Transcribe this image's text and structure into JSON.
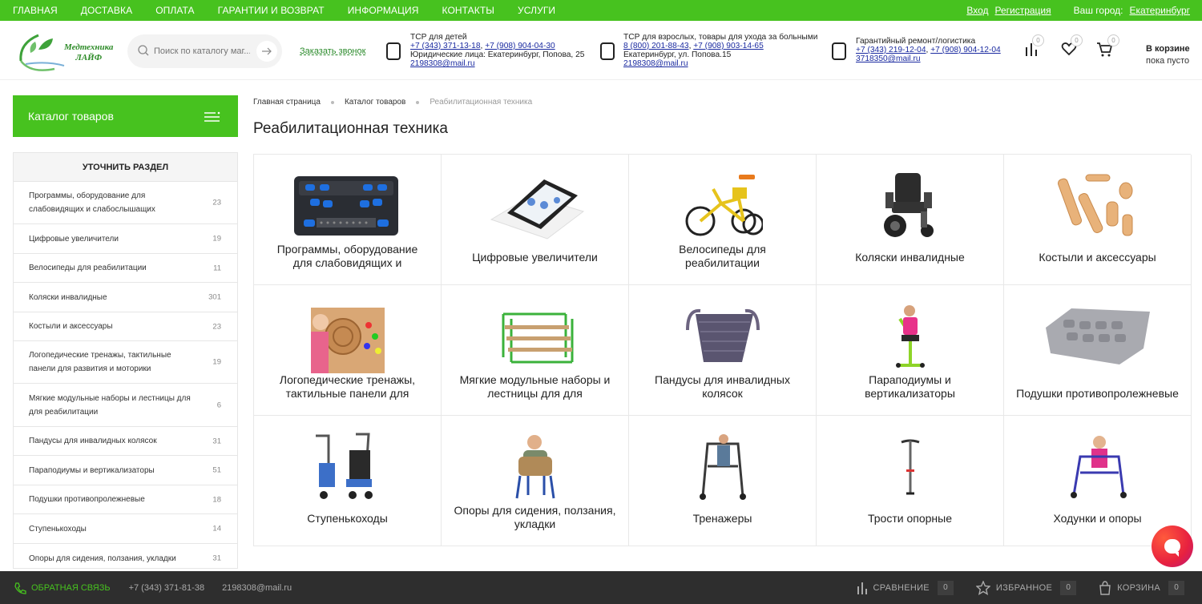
{
  "top_nav": {
    "items": [
      "ГЛАВНАЯ",
      "ДОСТАВКА",
      "ОПЛАТА",
      "ГАРАНТИИ И ВОЗВРАТ",
      "ИНФОРМАЦИЯ",
      "КОНТАКТЫ",
      "УСЛУГИ"
    ],
    "login": "Вход",
    "register": "Регистрация",
    "city_label": "Ваш город:",
    "city": "Екатеринбург"
  },
  "header": {
    "logo_line1": "Медтехника",
    "logo_line2": "ЛАЙФ",
    "search_placeholder": "Поиск по каталогу маг...",
    "callback": "Заказать звонок",
    "contacts": [
      {
        "title": "ТСР для детей",
        "phone1": "+7 (343) 371-13-18",
        "phone2": "+7 (908) 904-04-30",
        "line3": "Юридические лица: Екатеринбург, Попова, 25",
        "email": "2198308@mail.ru"
      },
      {
        "title": "ТСР для взрослых, товары для ухода за больными",
        "phone1": "8 (800) 201-88-43",
        "phone2": "+7 (908) 903-14-65",
        "line3": "Екатеринбург, ул. Попова.15",
        "email": "2198308@mail.ru"
      },
      {
        "title": "Гарантийный ремонт/логистика",
        "phone1": "+7 (343) 219-12-04",
        "phone2": "+7 (908) 904-12-04",
        "line3": "",
        "email": "3718350@mail.ru"
      }
    ],
    "compare_count": "0",
    "favorites_count": "0",
    "cart_count": "0",
    "basket_title": "В корзине",
    "basket_status": "пока пусто"
  },
  "sidebar": {
    "catalog_button": "Каталог товаров",
    "refine_title": "УТОЧНИТЬ РАЗДЕЛ",
    "items": [
      {
        "label": "Программы, оборудование для слабовидящих и слабослышащих",
        "count": "23"
      },
      {
        "label": "Цифровые увеличители",
        "count": "19"
      },
      {
        "label": "Велосипеды для реабилитации",
        "count": "11"
      },
      {
        "label": "Коляски инвалидные",
        "count": "301"
      },
      {
        "label": "Костыли и аксессуары",
        "count": "23"
      },
      {
        "label": "Логопедические тренажы, тактильные панели для развития и моторики",
        "count": "19"
      },
      {
        "label": "Мягкие модульные наборы и лестницы для для реабилитации",
        "count": "6"
      },
      {
        "label": "Пандусы для инвалидных колясок",
        "count": "31"
      },
      {
        "label": "Параподиумы и вертикализаторы",
        "count": "51"
      },
      {
        "label": "Подушки противопролежневые",
        "count": "18"
      },
      {
        "label": "Ступенькоходы",
        "count": "14"
      },
      {
        "label": "Опоры для сидения, ползания, укладки",
        "count": "31"
      }
    ]
  },
  "main": {
    "breadcrumb": [
      "Главная страница",
      "Каталог товаров",
      "Реабилитационная техника"
    ],
    "title": "Реабилитационная техника",
    "categories": [
      {
        "label": "Программы, оборудование для слабовидящих и",
        "icon": "braille-display"
      },
      {
        "label": "Цифровые увеличители",
        "icon": "digital-magnifier"
      },
      {
        "label": "Велосипеды для реабилитации",
        "icon": "rehab-tricycle"
      },
      {
        "label": "Коляски инвалидные",
        "icon": "power-wheelchair"
      },
      {
        "label": "Костыли и аксессуары",
        "icon": "wooden-crutches"
      },
      {
        "label": "Логопедические тренажы, тактильные панели для",
        "icon": "tactile-panel-photo"
      },
      {
        "label": "Мягкие модульные наборы и лестницы для для",
        "icon": "modular-ladder"
      },
      {
        "label": "Пандусы для инвалидных колясок",
        "icon": "wheelchair-ramp"
      },
      {
        "label": "Параподиумы и вертикализаторы",
        "icon": "stander"
      },
      {
        "label": "Подушки противопролежневые",
        "icon": "anti-decubitus-cushion"
      },
      {
        "label": "Ступенькоходы",
        "icon": "stair-climber"
      },
      {
        "label": "Опоры для сидения, ползания, укладки",
        "icon": "seating-support"
      },
      {
        "label": "Тренажеры",
        "icon": "gait-trainer"
      },
      {
        "label": "Трости опорные",
        "icon": "walking-cane"
      },
      {
        "label": "Ходунки и опоры",
        "icon": "walker"
      }
    ]
  },
  "bottom_bar": {
    "feedback": "ОБРАТНАЯ СВЯЗЬ",
    "phone": "+7 (343) 371-81-38",
    "email": "2198308@mail.ru",
    "compare_label": "СРАВНЕНИЕ",
    "compare_count": "0",
    "favorites_label": "ИЗБРАННОЕ",
    "favorites_count": "0",
    "cart_label": "КОРЗИНА",
    "cart_count": "0"
  },
  "colors": {
    "brand_green": "#47c21f",
    "bottom_bar": "#2e2e2e",
    "link_blue": "#1a2aa0"
  }
}
